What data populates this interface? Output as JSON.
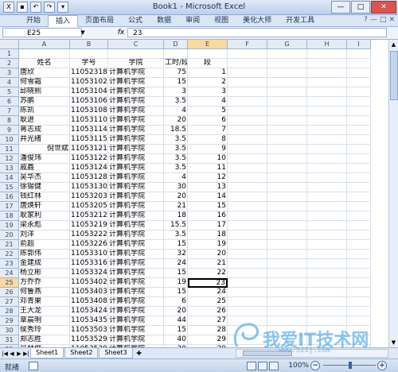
{
  "window": {
    "title": "Book1 - Microsoft Excel",
    "qat_icons": [
      "excel-logo-icon",
      "save-icon",
      "undo-icon",
      "redo-icon",
      "quick-access-dropdown-icon"
    ],
    "controls": {
      "minimize": "—",
      "maximize": "□",
      "close": "✕"
    }
  },
  "ribbon": {
    "tabs": [
      "开始",
      "插入",
      "页面布局",
      "公式",
      "数据",
      "审阅",
      "视图",
      "美化大师",
      "开发工具"
    ],
    "active_tab": "插入",
    "right_icons": [
      "?",
      "—",
      "□",
      "✕"
    ]
  },
  "formula_bar": {
    "name_box": "E25",
    "fx_label": "fx",
    "value": "23"
  },
  "columns": [
    "A",
    "B",
    "C",
    "D",
    "E",
    "F",
    "G",
    "H",
    "I"
  ],
  "selected_column": "E",
  "selected_row": "25",
  "headers": [
    "姓名",
    "学号",
    "学院",
    "工时/段",
    "段"
  ],
  "rows": [
    [
      "",
      "",
      "",
      "",
      ""
    ],
    [
      "姓名",
      "学号",
      "学院",
      "工时/段",
      "段"
    ],
    [
      "唐欣",
      "11052318",
      "计算机学院",
      "75",
      "1"
    ],
    [
      "何雪霜",
      "11053102",
      "计算机学院",
      "15",
      "2"
    ],
    [
      "邱晓熙",
      "11053104",
      "计算机学院",
      "3",
      "3"
    ],
    [
      "苏鹏",
      "11053106",
      "计算机学院",
      "3.5",
      "4"
    ],
    [
      "陈凯",
      "11053108",
      "计算机学院",
      "4",
      "5"
    ],
    [
      "耿进",
      "11053110",
      "计算机学院",
      "20",
      "6"
    ],
    [
      "蒋志成",
      "11053114",
      "计算机学院",
      "18.5",
      "7"
    ],
    [
      "井光绪",
      "11053115",
      "计算机学院",
      "3.5",
      "8"
    ],
    [
      "倪世斌",
      "11053121",
      "计算机学院",
      "3.5",
      "9"
    ],
    [
      "潘俊玮",
      "11053122",
      "计算机学院",
      "3.5",
      "10"
    ],
    [
      "戚鑫",
      "11053124",
      "计算机学院",
      "3.5",
      "11"
    ],
    [
      "吴华杰",
      "11053128",
      "计算机学院",
      "4",
      "12"
    ],
    [
      "徐锡健",
      "11053130",
      "计算机学院",
      "30",
      "13"
    ],
    [
      "钱红林",
      "11053203",
      "计算机学院",
      "20",
      "14"
    ],
    [
      "唐焕轩",
      "11053205",
      "计算机学院",
      "21",
      "15"
    ],
    [
      "耿家利",
      "11053212",
      "计算机学院",
      "18",
      "16"
    ],
    [
      "梁永彪",
      "11053219",
      "计算机学院",
      "15.5",
      "17"
    ],
    [
      "刘洋",
      "11053222",
      "计算机学院",
      "3.5",
      "18"
    ],
    [
      "俞超",
      "11053226",
      "计算机学院",
      "15",
      "19"
    ],
    [
      "陈郭伟",
      "11053310",
      "计算机学院",
      "32",
      "20"
    ],
    [
      "金建成",
      "11053316",
      "计算机学院",
      "24",
      "21"
    ],
    [
      "杨立彬",
      "11053324",
      "计算机学院",
      "15",
      "22"
    ],
    [
      "方乔乔",
      "11053402",
      "计算机学院",
      "19",
      "23"
    ],
    [
      "何鲁燕",
      "11053403",
      "计算机学院",
      "15",
      "24"
    ],
    [
      "邓青果",
      "11053408",
      "计算机学院",
      "6",
      "25"
    ],
    [
      "王大龙",
      "11053424",
      "计算机学院",
      "20",
      "26"
    ],
    [
      "覃晨明",
      "11053435",
      "计算机学院",
      "44",
      "27"
    ],
    [
      "侯秀玲",
      "11053503",
      "计算机学院",
      "15",
      "28"
    ],
    [
      "郑志胜",
      "11053529",
      "计算机学院",
      "40",
      "29"
    ],
    [
      "吴林俊",
      "11053539",
      "计算机学院",
      "30",
      "30"
    ]
  ],
  "sheets": [
    "Sheet1",
    "Sheet2",
    "Sheet3"
  ],
  "active_sheet": "Sheet1",
  "status": {
    "text": "就绪",
    "zoom": "100%"
  },
  "watermark": {
    "text": "我爱IT技术网",
    "sub": "www.52ij.com"
  }
}
